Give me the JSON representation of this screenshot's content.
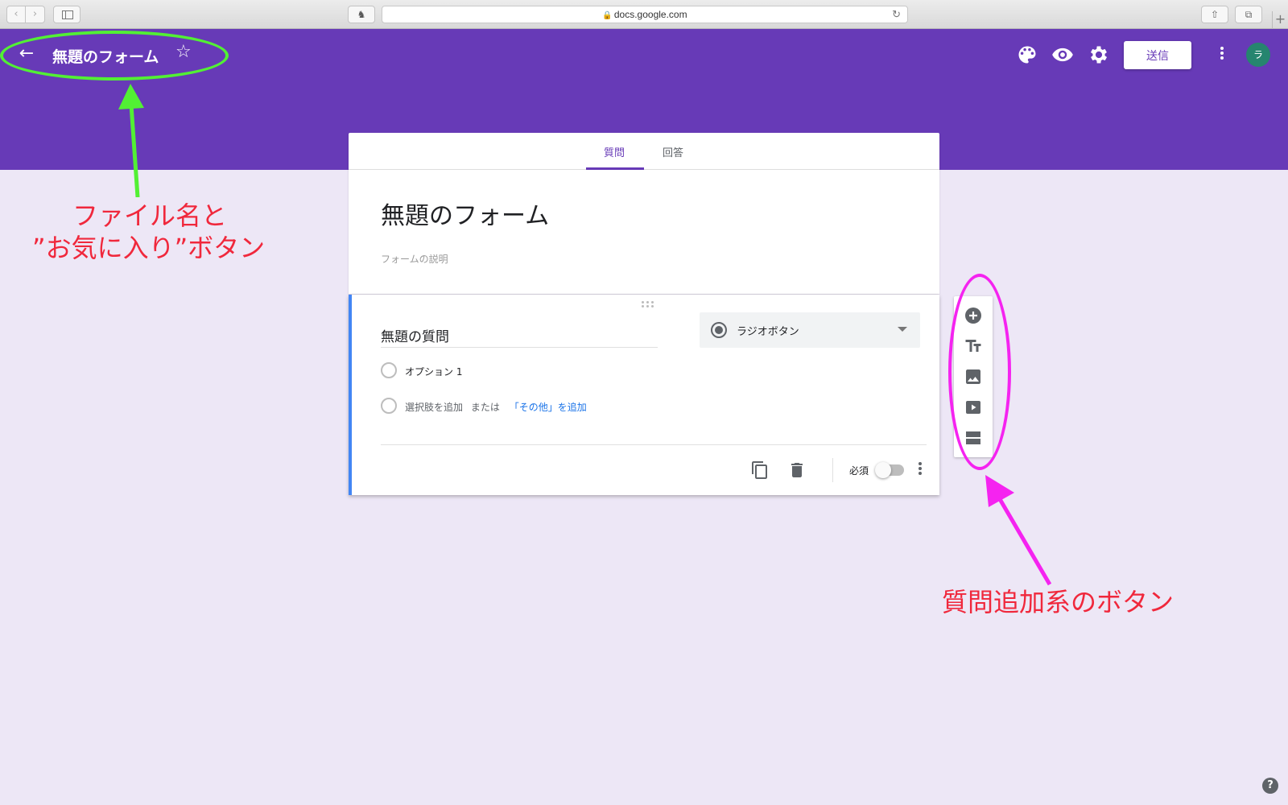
{
  "browser": {
    "url": "docs.google.com",
    "back_glyph": "‹",
    "forward_glyph": "›",
    "reload_glyph": "↻",
    "share_glyph": "⇧",
    "tabs_glyph": "⧉",
    "newtab_glyph": "+",
    "ext_glyph": "♞"
  },
  "header": {
    "form_name": "無題のフォーム",
    "send_label": "送信",
    "avatar_letter": "ラ",
    "back_glyph": "←",
    "star_glyph": "☆",
    "icons": [
      "palette-icon",
      "preview-eye-icon",
      "settings-gear-icon",
      "more-vert-icon"
    ]
  },
  "tabs": {
    "questions": "質問",
    "responses": "回答"
  },
  "form": {
    "title": "無題のフォーム",
    "description_placeholder": "フォームの説明"
  },
  "question": {
    "title": "無題の質問",
    "type": "ラジオボタン",
    "option1": "オプション 1",
    "add_option": "選択肢を追加",
    "or": "または",
    "add_other": "「その他」を追加",
    "required_label": "必須",
    "required": false
  },
  "tool_panel": {
    "icons": [
      "add-question-icon",
      "add-title-icon",
      "add-image-icon",
      "add-video-icon",
      "add-section-icon"
    ]
  },
  "annotations": {
    "file_name_line1": "ファイル名と",
    "file_name_line2": "”お気に入り”ボタン",
    "add_buttons": "質問追加系のボタン"
  },
  "colors": {
    "theme": "#673ab7",
    "background": "#ede7f6",
    "accent_blue": "#4285f4",
    "annotation_green": "#52f034",
    "annotation_magenta": "#f523f0",
    "annotation_red": "#f0283c"
  },
  "help_glyph": "?"
}
